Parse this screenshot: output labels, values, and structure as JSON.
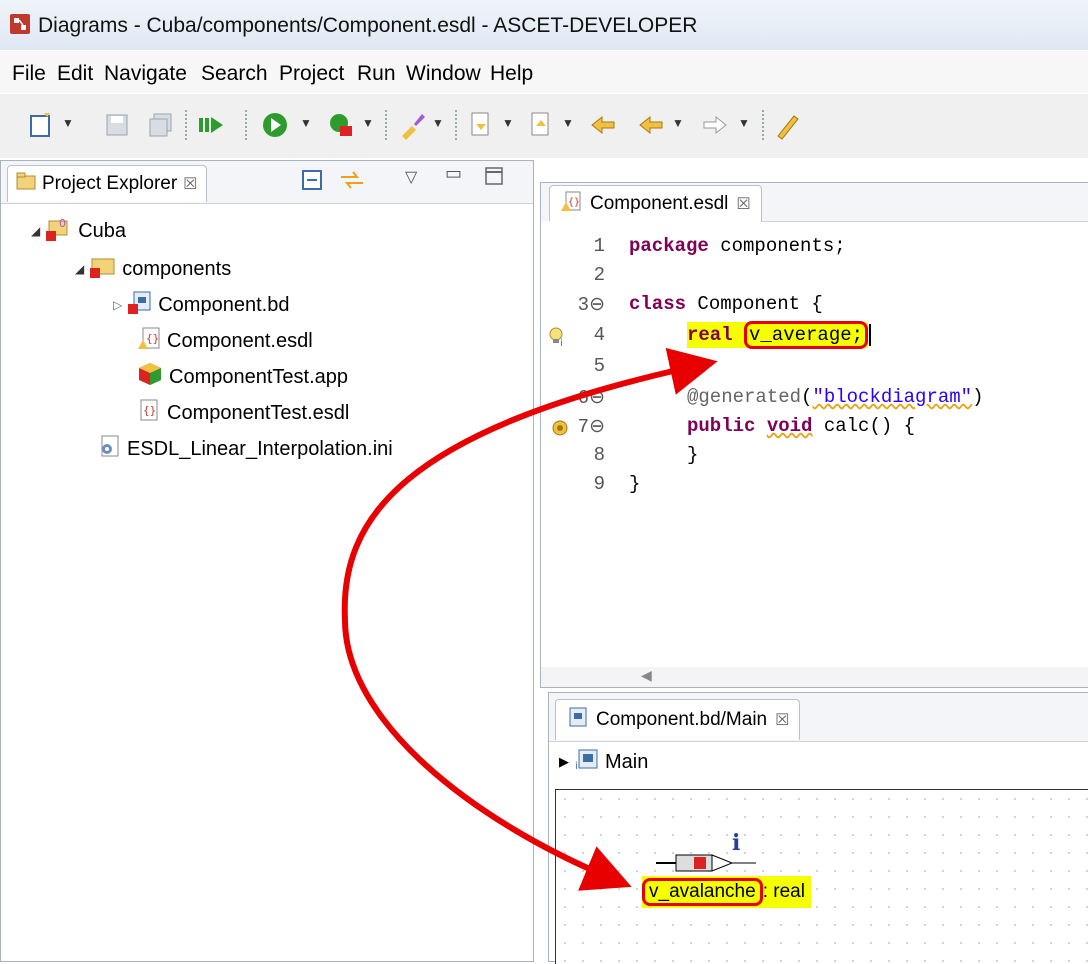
{
  "window": {
    "title": "Diagrams - Cuba/components/Component.esdl - ASCET-DEVELOPER"
  },
  "menu": [
    "File",
    "Edit",
    "Navigate",
    "Search",
    "Project",
    "Run",
    "Window",
    "Help"
  ],
  "toolbar": {
    "icons": [
      "new-icon",
      "save-icon",
      "save-all-icon",
      "step-icon",
      "run-icon",
      "debug-icon",
      "brush-icon",
      "next-annotation-icon",
      "prev-annotation-icon",
      "back-icon",
      "forward-icon",
      "pen-icon"
    ]
  },
  "project_explorer": {
    "tab_label": "Project Explorer",
    "tree": [
      {
        "label": "Cuba",
        "level": 0,
        "expanded": true
      },
      {
        "label": "components",
        "level": 1,
        "expanded": true
      },
      {
        "label": "Component.bd",
        "level": 2,
        "expanded": false
      },
      {
        "label": "Component.esdl",
        "level": 2
      },
      {
        "label": "ComponentTest.app",
        "level": 2
      },
      {
        "label": "ComponentTest.esdl",
        "level": 2
      },
      {
        "label": "ESDL_Linear_Interpolation.ini",
        "level": 1
      }
    ]
  },
  "editor": {
    "tab_label": "Component.esdl",
    "lines": [
      {
        "num": "1",
        "code": "package components;"
      },
      {
        "num": "2",
        "code": ""
      },
      {
        "num": "3⊖",
        "code": "class Component {"
      },
      {
        "num": "4",
        "code": "real v_average;"
      },
      {
        "num": "5",
        "code": ""
      },
      {
        "num": "6⊖",
        "code": "@generated(\"blockdiagram\")"
      },
      {
        "num": "7⊖",
        "code": "public void calc() {"
      },
      {
        "num": "8",
        "code": "}"
      },
      {
        "num": "9",
        "code": "}"
      }
    ]
  },
  "block_diagram": {
    "tab_label": "Component.bd/Main",
    "breadcrumb": "Main",
    "element_label": "v_avalanche",
    "element_type": ": real",
    "info_marker": "i"
  },
  "colors": {
    "highlight": "#f5ff00",
    "arrow": "#e80000",
    "keyword": "#7f0055",
    "string": "#2a00ff"
  }
}
